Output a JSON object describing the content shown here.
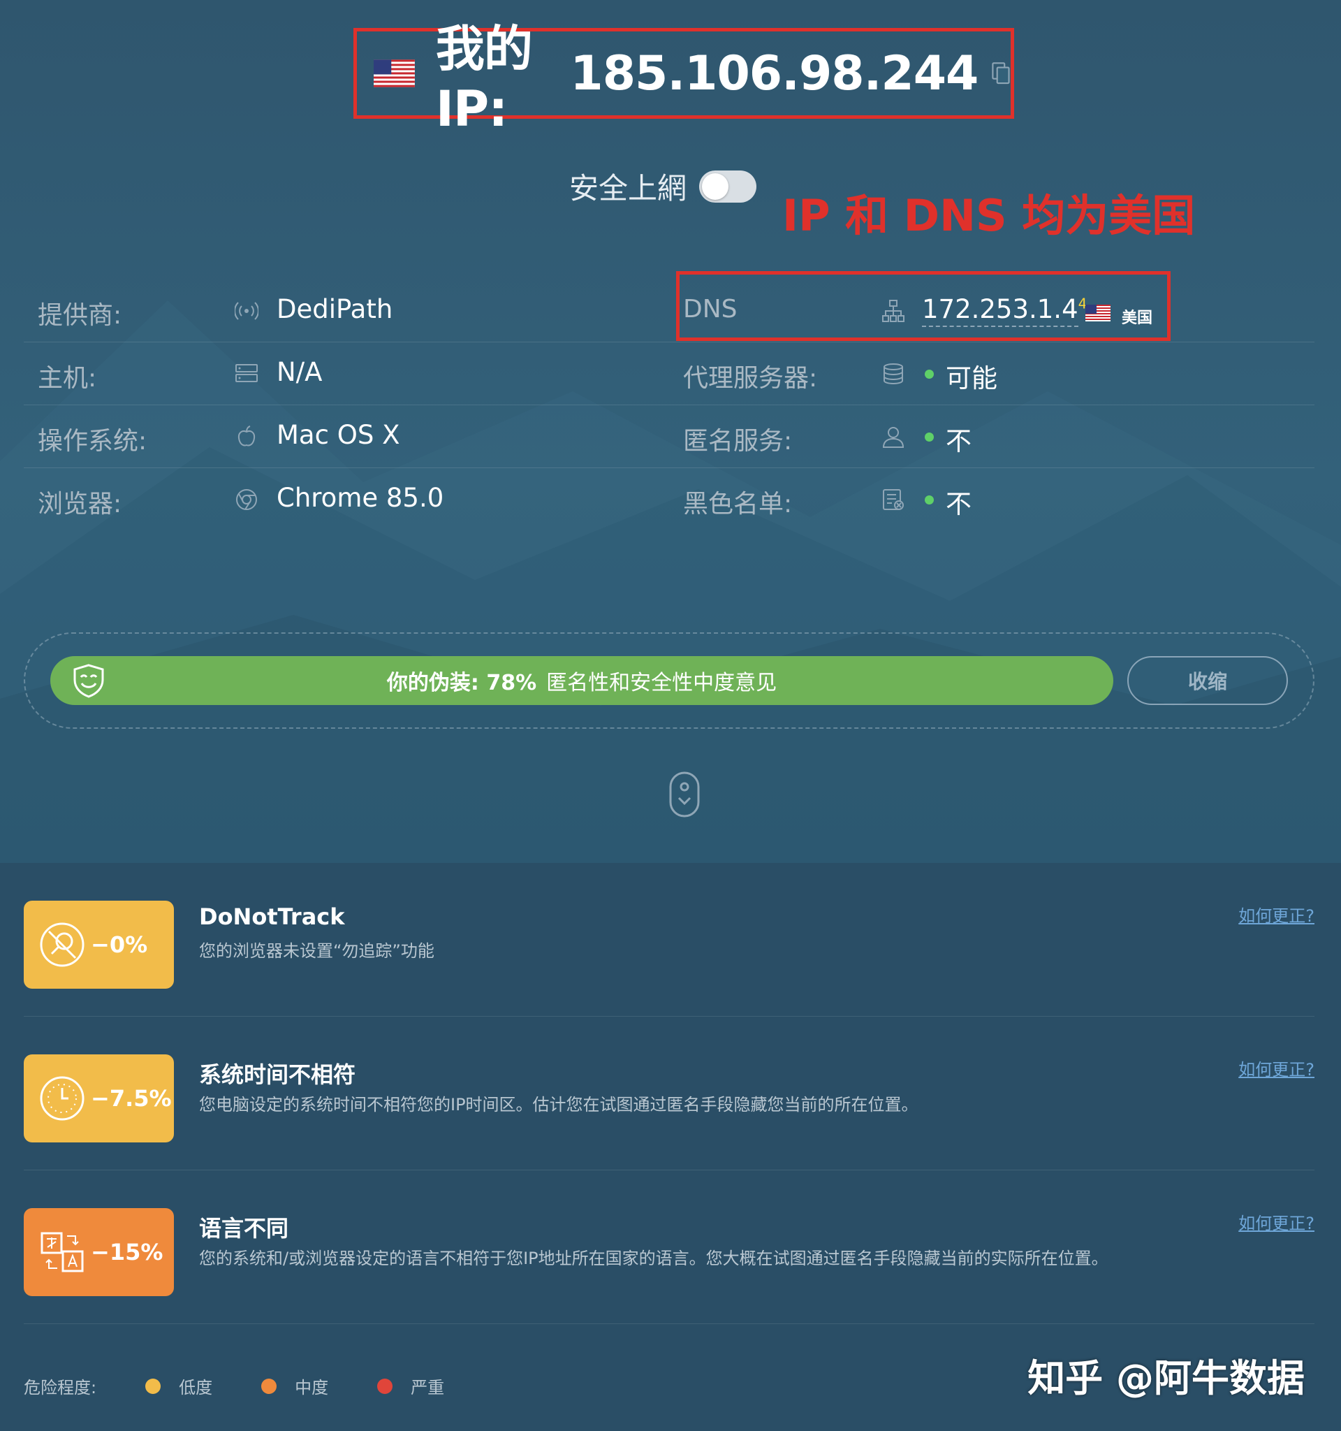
{
  "header": {
    "ip_label": "我的IP:",
    "ip_address": "185.106.98.244"
  },
  "secure": {
    "label": "安全上網",
    "enabled": false
  },
  "annotation": "IP 和 DNS 均为美国",
  "info": {
    "provider": {
      "label": "提供商:",
      "value": "DediPath"
    },
    "host": {
      "label": "主机:",
      "value": "N/A"
    },
    "os": {
      "label": "操作系统:",
      "value": "Mac OS X"
    },
    "browser": {
      "label": "浏览器:",
      "value": "Chrome 85.0"
    },
    "dns": {
      "label": "DNS",
      "value": "172.253.1.4",
      "count": "4",
      "country": "美国"
    },
    "proxy": {
      "label": "代理服务器:",
      "value": "可能"
    },
    "anonymizer": {
      "label": "匿名服务:",
      "value": "不"
    },
    "blacklist": {
      "label": "黑色名单:",
      "value": "不"
    }
  },
  "status_color": "#5fd068",
  "disguise": {
    "label": "你的伪装: 78%",
    "percent": 78,
    "description": "匿名性和安全性中度意见",
    "collapse_label": "收缩",
    "bar_color": "#6fb257"
  },
  "issues": [
    {
      "badge": "−0%",
      "icon": "search-off-icon",
      "color": "#f2bc4a",
      "title": "DoNotTrack",
      "description": "您的浏览器未设置“勿追踪”功能",
      "link": "如何更正?"
    },
    {
      "badge": "−7.5%",
      "icon": "clock-icon",
      "color": "#f2bc4a",
      "title": "系统时间不相符",
      "description": "您电脑设定的系统时间不相符您的IP时间区。估计您在试图通过匿名手段隐藏您当前的所在位置。",
      "link": "如何更正?"
    },
    {
      "badge": "−15%",
      "icon": "translate-icon",
      "color": "#ef8a3c",
      "title": "语言不同",
      "description": "您的系统和/或浏览器设定的语言不相符于您IP地址所在国家的语言。您大概在试图通过匿名手段隐藏当前的实际所在位置。",
      "link": "如何更正?"
    }
  ],
  "legend": {
    "label": "危险程度:",
    "items": [
      {
        "label": "低度",
        "color": "#f2bc4a"
      },
      {
        "label": "中度",
        "color": "#ef8a3c"
      },
      {
        "label": "严重",
        "color": "#e0453a"
      }
    ]
  },
  "watermark": "知乎 @阿牛数据"
}
